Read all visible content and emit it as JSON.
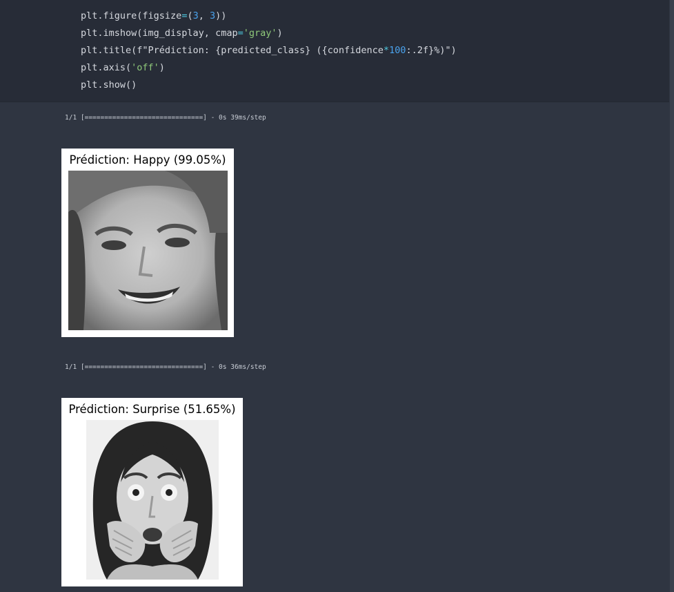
{
  "code": {
    "lines": [
      [
        {
          "t": "plt.figure(figsize"
        },
        {
          "t": "=",
          "c": "op"
        },
        {
          "t": "("
        },
        {
          "t": "3",
          "c": "num"
        },
        {
          "t": ", "
        },
        {
          "t": "3",
          "c": "num"
        },
        {
          "t": "))"
        }
      ],
      [
        {
          "t": "plt.imshow(img_display, cmap"
        },
        {
          "t": "=",
          "c": "op"
        },
        {
          "t": "'gray'",
          "c": "str"
        },
        {
          "t": ")"
        }
      ],
      [
        {
          "t": "plt.title(f\"Prédiction: {predicted_class} ({confidence"
        },
        {
          "t": "*",
          "c": "op"
        },
        {
          "t": "100",
          "c": "num"
        },
        {
          "t": ":.2f}%)\")"
        }
      ],
      [
        {
          "t": "plt.axis("
        },
        {
          "t": "'off'",
          "c": "str"
        },
        {
          "t": ")"
        }
      ],
      [
        {
          "t": "plt.show()"
        }
      ]
    ]
  },
  "outputs": [
    {
      "progress_text": "1/1 [==============================] - 0s 39ms/step",
      "figure_title": "Prédiction: Happy (99.05%)",
      "image_label": "grayscale face smiling"
    },
    {
      "progress_text": "1/1 [==============================] - 0s 36ms/step",
      "figure_title": "Prédiction: Surprise (51.65%)",
      "image_label": "grayscale face frightened with hands at mouth"
    }
  ]
}
